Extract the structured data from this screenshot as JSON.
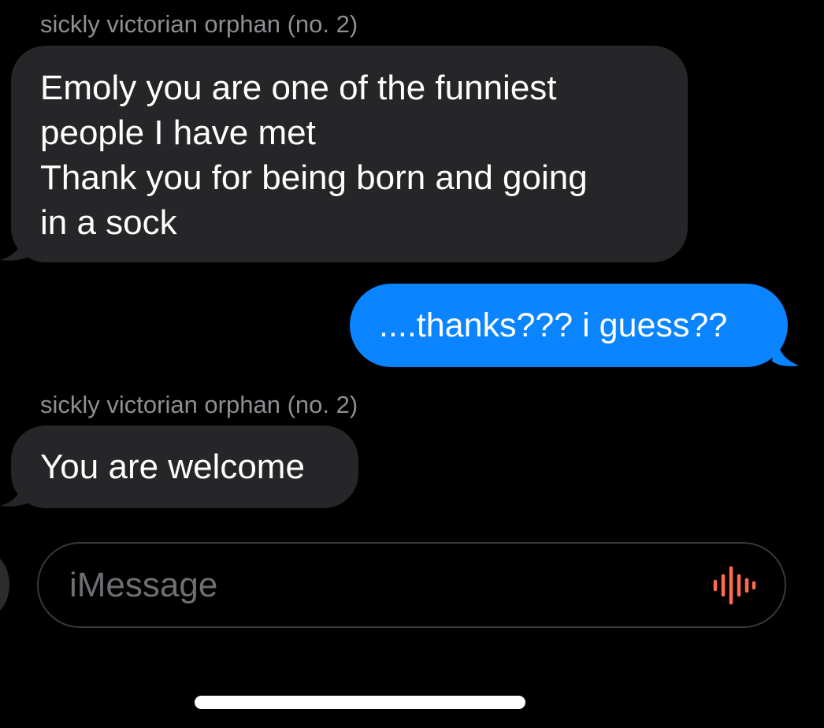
{
  "conversation": {
    "messages": [
      {
        "direction": "incoming",
        "sender": "sickly victorian orphan (no. 2)",
        "lines": [
          "Emoly you are one of the funniest",
          "people I have met",
          "Thank you for being born and going",
          "in a sock"
        ]
      },
      {
        "direction": "outgoing",
        "lines": [
          "....thanks??? i guess??"
        ]
      },
      {
        "direction": "incoming",
        "sender": "sickly victorian orphan (no. 2)",
        "lines": [
          "You are welcome"
        ]
      }
    ]
  },
  "composer": {
    "placeholder": "iMessage",
    "audio_icon": "waveform-icon"
  },
  "colors": {
    "background": "#000000",
    "incoming_bubble": "#262628",
    "outgoing_bubble": "#0a84ff",
    "sender_name": "#8e8e93",
    "placeholder": "#6e6e73",
    "waveform": "#ff6b4f"
  }
}
